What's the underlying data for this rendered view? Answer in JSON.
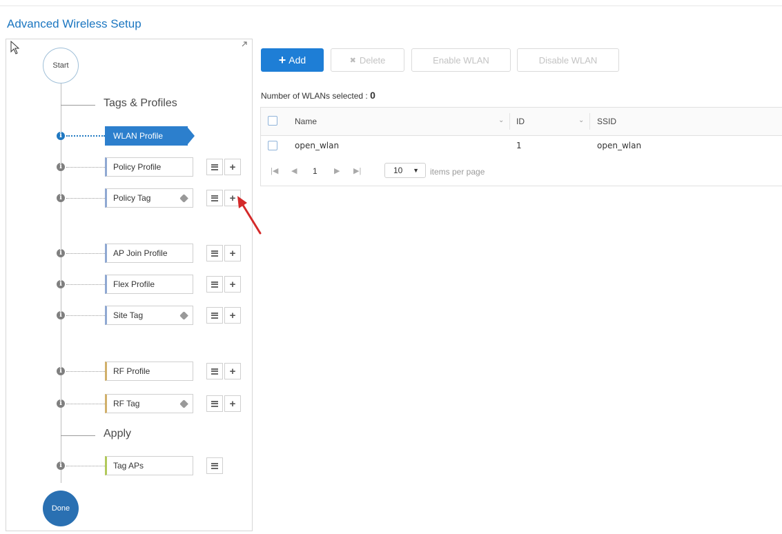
{
  "page": {
    "title": "Advanced Wireless Setup"
  },
  "wizard": {
    "start_label": "Start",
    "done_label": "Done",
    "sections": [
      {
        "label": "Tags & Profiles"
      },
      {
        "label": "Apply"
      }
    ],
    "steps": [
      {
        "label": "WLAN Profile",
        "active": true,
        "tag": false,
        "list_button": false,
        "add_button": false
      },
      {
        "label": "Policy Profile",
        "active": false,
        "tag": false,
        "list_button": true,
        "add_button": true
      },
      {
        "label": "Policy Tag",
        "active": false,
        "tag": true,
        "list_button": true,
        "add_button": true
      },
      {
        "label": "AP Join Profile",
        "active": false,
        "tag": false,
        "list_button": true,
        "add_button": true
      },
      {
        "label": "Flex Profile",
        "active": false,
        "tag": false,
        "list_button": true,
        "add_button": true
      },
      {
        "label": "Site Tag",
        "active": false,
        "tag": true,
        "list_button": true,
        "add_button": true
      },
      {
        "label": "RF Profile",
        "active": false,
        "tag": false,
        "list_button": true,
        "add_button": true
      },
      {
        "label": "RF Tag",
        "active": false,
        "tag": true,
        "list_button": true,
        "add_button": true
      },
      {
        "label": "Tag APs",
        "active": false,
        "tag": false,
        "list_button": true,
        "add_button": false
      }
    ],
    "info_icon_glyph": "i",
    "add_glyph": "+"
  },
  "toolbar": {
    "add_label": "Add",
    "add_glyph": "+",
    "delete_label": "Delete",
    "delete_glyph": "✖",
    "enable_label": "Enable WLAN",
    "disable_label": "Disable WLAN"
  },
  "selection": {
    "label": "Number of WLANs selected :",
    "count": "0"
  },
  "table": {
    "columns": [
      {
        "label": "Name"
      },
      {
        "label": "ID"
      },
      {
        "label": "SSID"
      }
    ],
    "rows": [
      {
        "name": "open_wlan",
        "id": "1",
        "ssid": "open_wlan"
      }
    ]
  },
  "pager": {
    "first_glyph": "|◀",
    "prev_glyph": "◀",
    "page": "1",
    "next_glyph": "▶",
    "last_glyph": "▶|",
    "per_page_value": "10",
    "per_page_label": "items per page"
  },
  "colors": {
    "accent": "#1e7ed6",
    "title": "#1b76c0",
    "active_step": "#2c7fcd",
    "done_circle": "#2a70b2",
    "annotation_arrow": "#d42a2a"
  }
}
